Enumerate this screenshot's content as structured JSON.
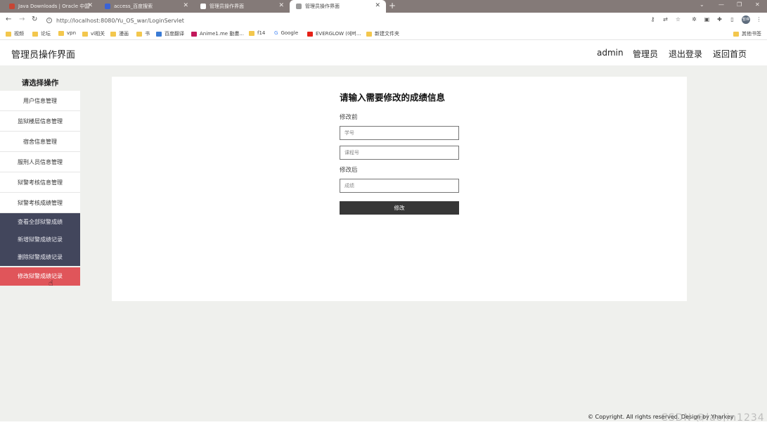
{
  "browser": {
    "tabs": [
      {
        "label": "Java Downloads | Oracle 中国",
        "color": "#c74634"
      },
      {
        "label": "access_百度搜索",
        "color": "#3a63d6"
      },
      {
        "label": "管理员操作界面",
        "color": "#ffffff"
      },
      {
        "label": "管理员操作界面",
        "color": "#7a7a7a",
        "active": true
      }
    ],
    "new_tab": "+",
    "url": "http://localhost:8080/Yu_OS_war/LoginServlet",
    "bookmarks": [
      "视频",
      "论坛",
      "vpn",
      "vl相关",
      "漫画",
      "书",
      "百度翻译",
      "Anime1.me 動畫...",
      "f14",
      "Google",
      "EVERGLOW (에버...",
      "新建文件夹"
    ],
    "other_bookmarks": "其他书签",
    "avatar": "暂停"
  },
  "header": {
    "title": "管理员操作界面",
    "nav": [
      "admin",
      "管理员",
      "退出登录",
      "返回首页"
    ]
  },
  "sidebar": {
    "title": "请选择操作",
    "items": [
      "用户信息管理",
      "监狱楼层信息管理",
      "宿舍信息管理",
      "服刑人员信息管理",
      "狱警考核信息管理",
      "狱警考核成绩管理"
    ],
    "sub_items": [
      "查看全部狱警成绩",
      "新增狱警成绩记录",
      "删除狱警成绩记录",
      "修改狱警成绩记录"
    ]
  },
  "form": {
    "title": "请输入需要修改的成绩信息",
    "before_label": "修改前",
    "student_id_placeholder": "学号",
    "course_id_placeholder": "课程号",
    "after_label": "修改后",
    "score_placeholder": "成绩",
    "submit_label": "修改"
  },
  "footer": {
    "copyright": "© Copyright. All rights reserved. Design by Yharkey"
  },
  "watermark": "CSDN @laojin1234",
  "colors": {
    "tab_bar": "#847a78",
    "page_bg": "#eff0ed",
    "submenu_bg": "#42465c",
    "submenu_active": "#e0555a",
    "button_bg": "#373737"
  }
}
